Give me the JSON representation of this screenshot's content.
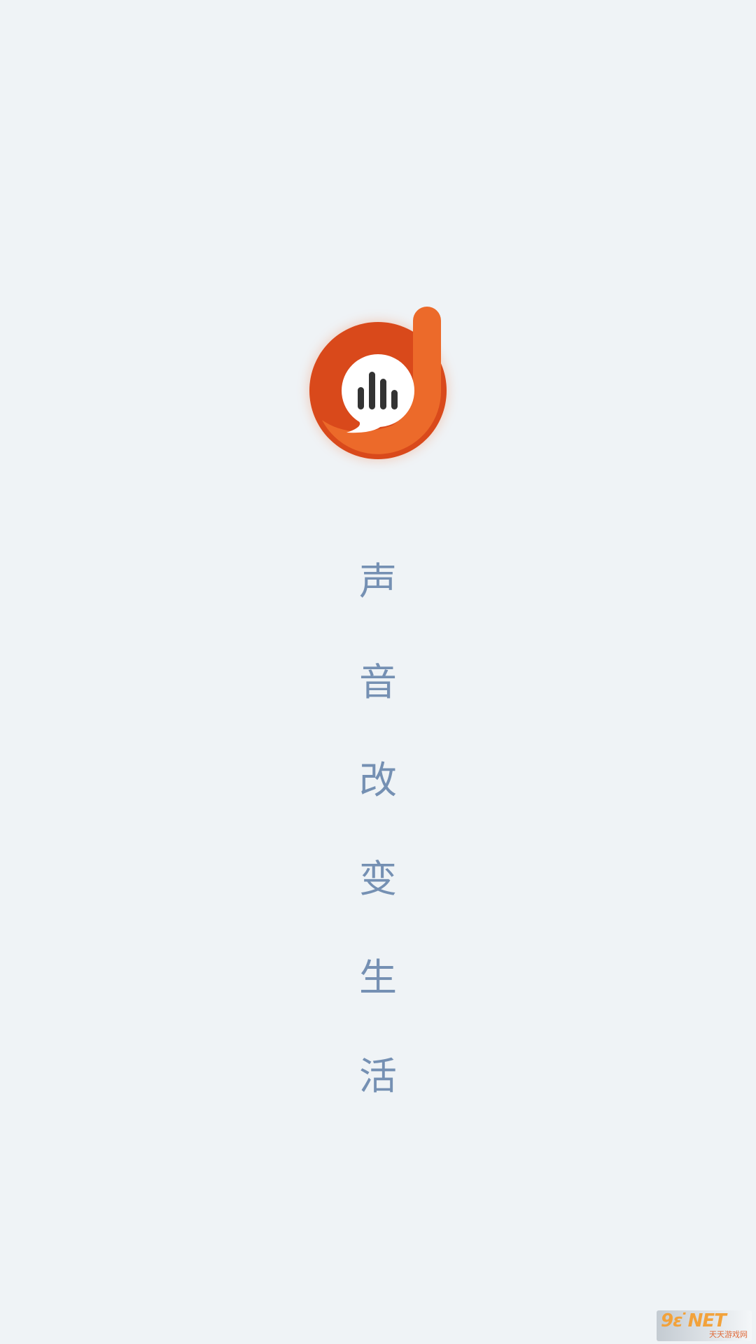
{
  "app": {
    "screen": "splash",
    "brand_colors": {
      "ring_dark": "#d9491b",
      "ring_light": "#ec6a2a",
      "bubble": "#ffffff",
      "bars": "#333333",
      "slogan": "#7590b3",
      "background": "#eff3f6"
    },
    "logo_icon": "voice-bubble-logo-icon"
  },
  "slogan": {
    "chars": [
      "声",
      "音",
      "改",
      "变",
      "生",
      "活"
    ]
  },
  "watermark": {
    "mark": "9ɛ͘ NET",
    "text": "天天游戏网"
  }
}
